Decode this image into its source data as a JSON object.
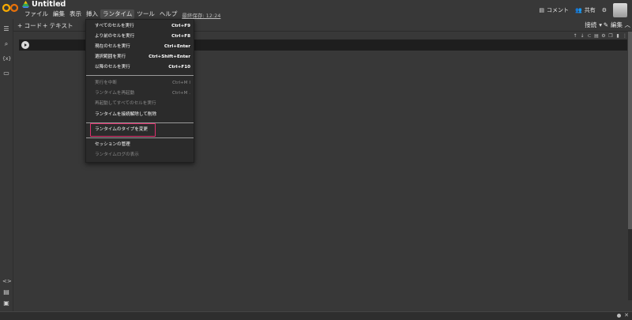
{
  "header": {
    "title": "Untitled",
    "menus": [
      "ファイル",
      "編集",
      "表示",
      "挿入",
      "ランタイム",
      "ツール",
      "ヘルプ"
    ],
    "last_saved": "最終保存: 12:24",
    "comment_label": "コメント",
    "share_label": "共有"
  },
  "toolbar": {
    "add_code": "+ コード",
    "add_text": "+ テキスト",
    "connect": "接続",
    "edit": "編集"
  },
  "dropdown": {
    "items": [
      {
        "label": "すべてのセルを実行",
        "shortcut": "Ctrl+F9"
      },
      {
        "label": "より前のセルを実行",
        "shortcut": "Ctrl+F8"
      },
      {
        "label": "現在のセルを実行",
        "shortcut": "Ctrl+Enter"
      },
      {
        "label": "選択範囲を実行",
        "shortcut": "Ctrl+Shift+Enter"
      },
      {
        "label": "以降のセルを実行",
        "shortcut": "Ctrl+F10"
      },
      {
        "label": "実行を中断",
        "shortcut": "Ctrl+M I"
      },
      {
        "label": "ランタイムを再起動",
        "shortcut": "Ctrl+M ."
      },
      {
        "label": "再起動してすべてのセルを実行",
        "shortcut": ""
      },
      {
        "label": "ランタイムを接続解除して削除",
        "shortcut": ""
      },
      {
        "label": "ランタイムのタイプを変更",
        "shortcut": ""
      },
      {
        "label": "セッションの管理",
        "shortcut": ""
      },
      {
        "label": "ランタイムログの表示",
        "shortcut": ""
      }
    ]
  },
  "colors": {
    "background": "#383838",
    "menu_bg": "#2b2b2b",
    "highlight": "#e0306e"
  }
}
